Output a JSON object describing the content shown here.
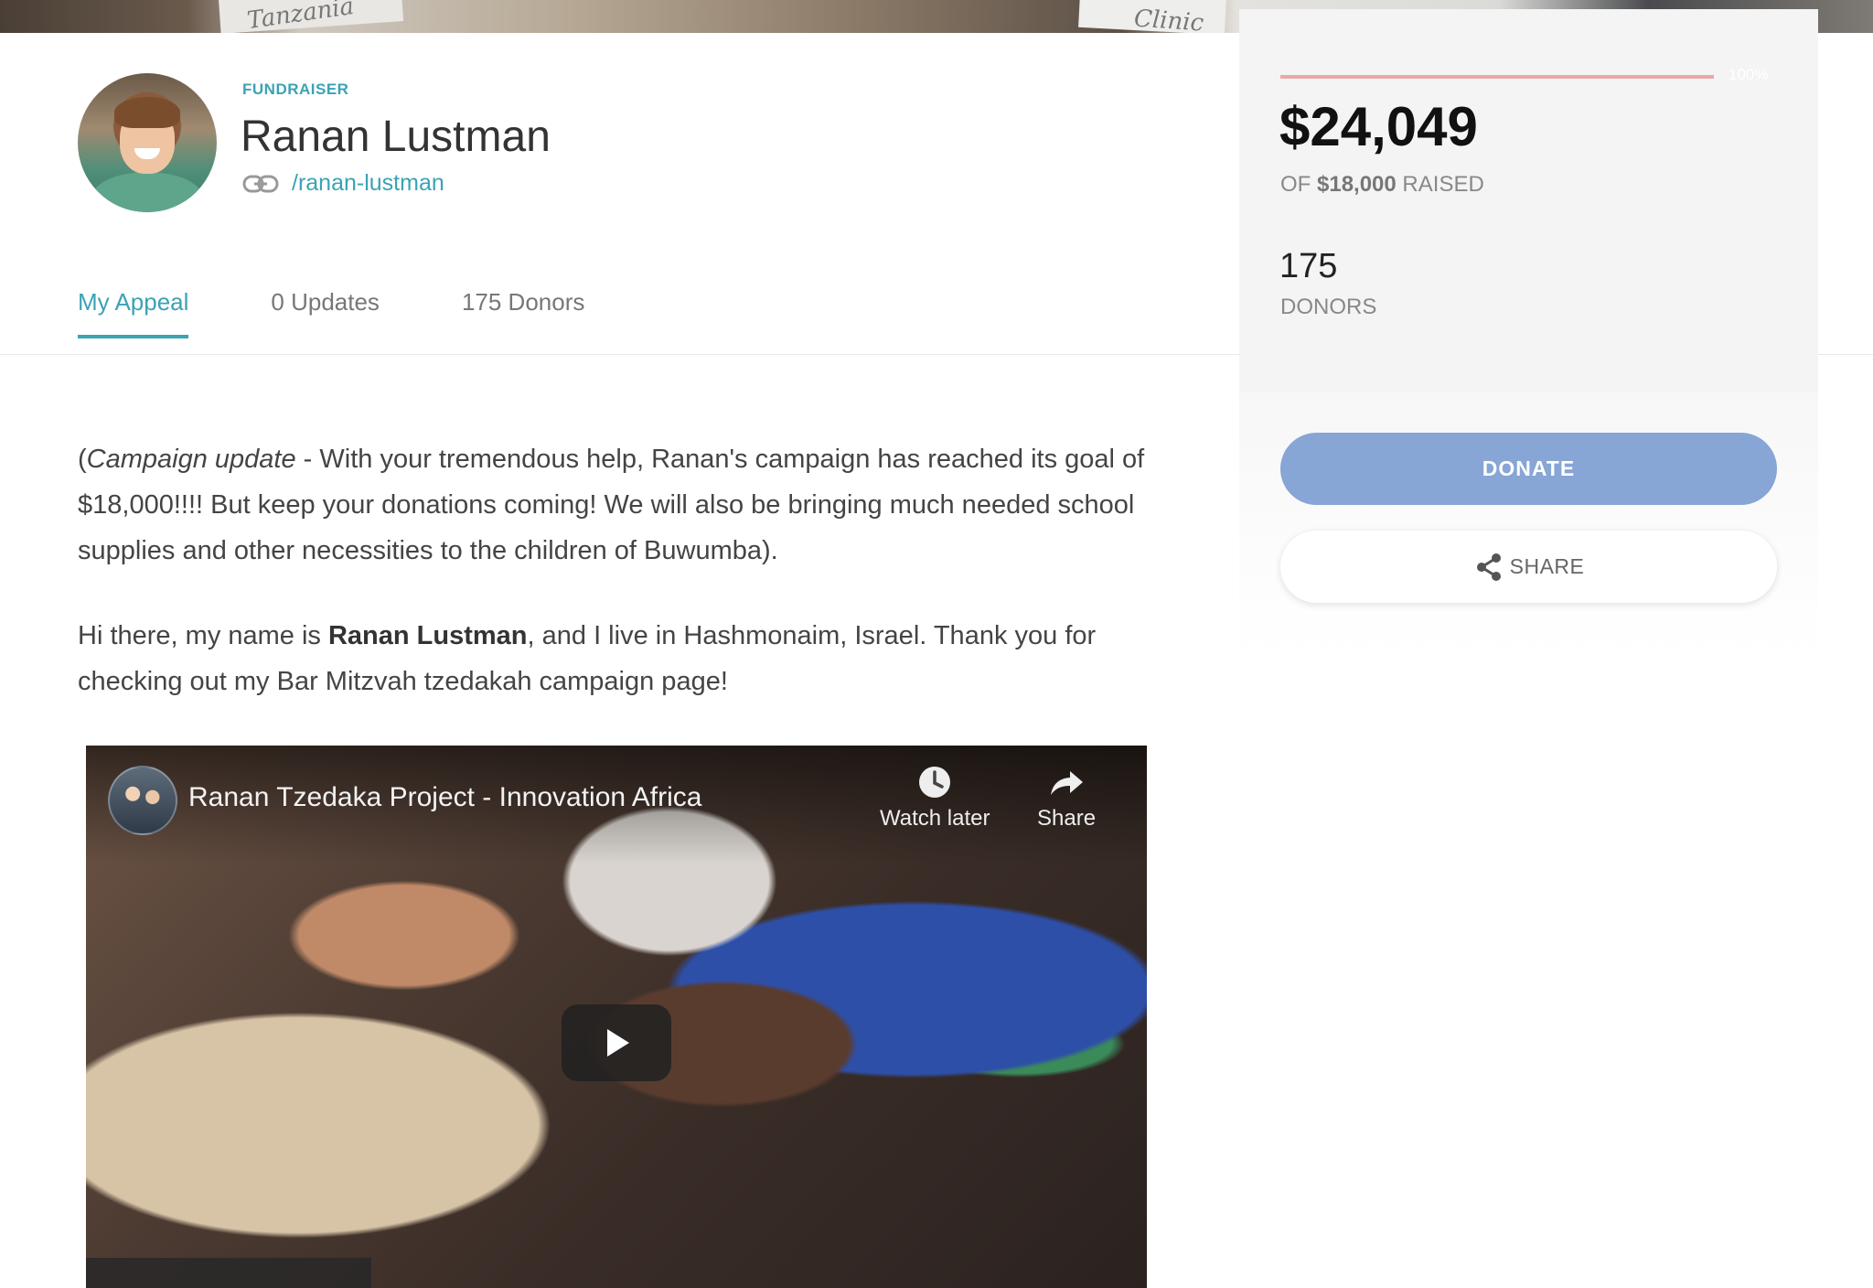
{
  "hero": {
    "caption_left": "Tanzania",
    "caption_right": "Clinic"
  },
  "profile": {
    "eyebrow": "FUNDRAISER",
    "name": "Ranan Lustman",
    "slug": "/ranan-lustman"
  },
  "tabs": [
    {
      "label": "My Appeal",
      "active": true
    },
    {
      "label": "0 Updates",
      "active": false
    },
    {
      "label": "175 Donors",
      "active": false
    }
  ],
  "appeal": {
    "para1": {
      "open_paren": "(",
      "emphasis": "Campaign update",
      "text": " - With your tremendous help, Ranan's campaign has reached its goal of $18,000!!!! But keep your donations coming! We will also be bringing much needed school supplies and other necessities to the children of Buwumba)."
    },
    "para2": {
      "before": "Hi there, my name is ",
      "bold": "Ranan Lustman",
      "after": ", and I live in Hashmonaim, Israel.  Thank you for checking out my Bar Mitzvah tzedakah campaign page!"
    }
  },
  "video": {
    "title": "Ranan Tzedaka Project - Innovation Africa",
    "watch_later": "Watch later",
    "share": "Share",
    "icons": [
      "clock-icon",
      "share-arrow-icon",
      "play-icon"
    ]
  },
  "stats": {
    "progress_percent": 100,
    "progress_label": "100%",
    "raised": "$24,049",
    "goal_prefix": "OF ",
    "goal": "$18,000",
    "goal_suffix": " RAISED",
    "donors_count": "175",
    "donors_label": "DONORS"
  },
  "actions": {
    "donate_label": "DONATE",
    "share_label": "SHARE"
  },
  "colors": {
    "accent": "#3aa3b4",
    "donate": "#87a5d5",
    "progress": "#e8a8a8"
  }
}
